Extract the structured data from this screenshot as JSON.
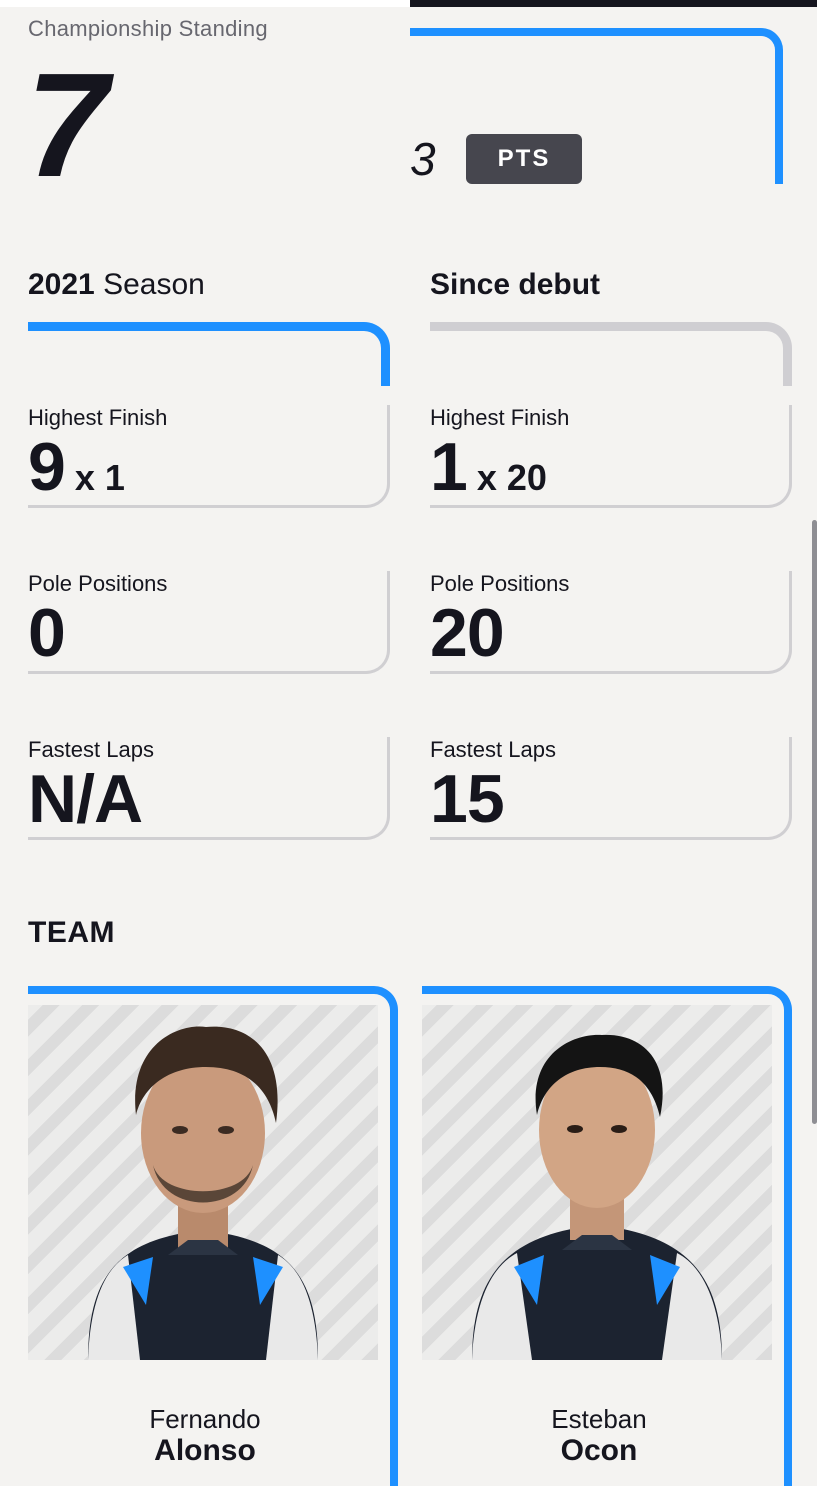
{
  "championship": {
    "label": "Championship Standing",
    "position": "7",
    "points": "3",
    "points_unit": "PTS"
  },
  "season": {
    "year": "2021",
    "label": "Season"
  },
  "career": {
    "label": "Since debut"
  },
  "season_stats": [
    {
      "label": "Highest Finish",
      "value": "9",
      "multiplier": "x 1"
    },
    {
      "label": "Pole Positions",
      "value": "0",
      "multiplier": ""
    },
    {
      "label": "Fastest Laps",
      "value": "N/A",
      "multiplier": ""
    }
  ],
  "career_stats": [
    {
      "label": "Highest Finish",
      "value": "1",
      "multiplier": "x 20"
    },
    {
      "label": "Pole Positions",
      "value": "20",
      "multiplier": ""
    },
    {
      "label": "Fastest Laps",
      "value": "15",
      "multiplier": ""
    }
  ],
  "team": {
    "title": "TEAM",
    "drivers": [
      {
        "first_name": "Fernando",
        "last_name": "Alonso"
      },
      {
        "first_name": "Esteban",
        "last_name": "Ocon"
      }
    ]
  },
  "colors": {
    "accent": "#1e90ff",
    "text": "#15151e",
    "badge": "#46464e",
    "background": "#f4f3f1"
  }
}
